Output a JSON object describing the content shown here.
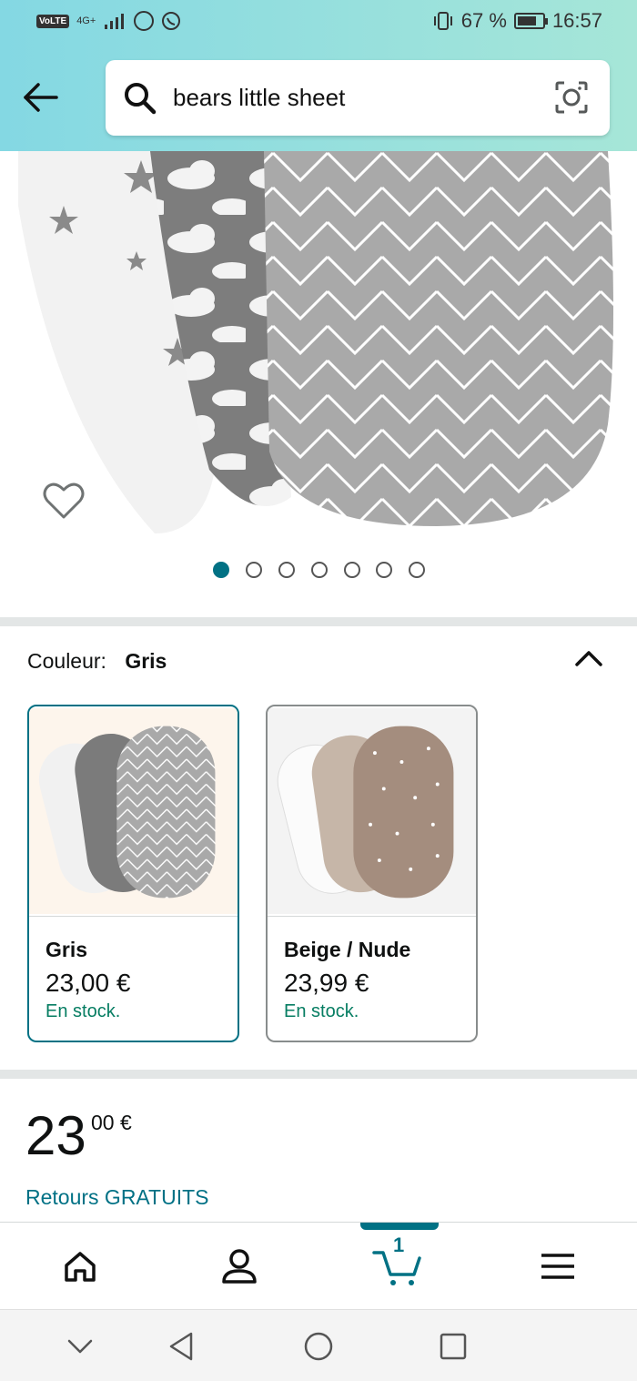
{
  "status_bar": {
    "volte": "VoLTE",
    "network": "4G+",
    "battery_percent": "67 %",
    "time": "16:57"
  },
  "search": {
    "query": "bears little sheet"
  },
  "carousel": {
    "active_index": 0,
    "count": 7
  },
  "color_section": {
    "label": "Couleur:",
    "selected": "Gris",
    "options": [
      {
        "name": "Gris",
        "price": "23,00 €",
        "stock": "En stock."
      },
      {
        "name": "Beige / Nude",
        "price": "23,99 €",
        "stock": "En stock."
      }
    ]
  },
  "price": {
    "whole": "23",
    "fraction": "00 €",
    "returns": "Retours GRATUITS"
  },
  "bottom_nav": {
    "cart_count": "1"
  },
  "colors": {
    "accent": "#017184",
    "stock_green": "#067d62",
    "header_start": "#84d8e3",
    "header_end": "#a6e6d8"
  }
}
